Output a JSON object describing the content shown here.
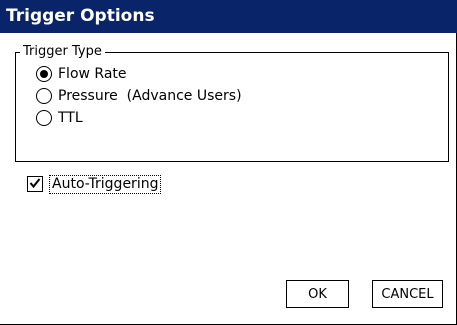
{
  "window": {
    "title": "Trigger Options"
  },
  "trigger_type": {
    "group_label": "Trigger Type",
    "options": [
      {
        "label": "Flow Rate",
        "selected": true
      },
      {
        "label": "Pressure  (Advance Users)",
        "selected": false
      },
      {
        "label": "TTL",
        "selected": false
      }
    ]
  },
  "auto_triggering": {
    "label": "Auto-Triggering",
    "checked": true
  },
  "buttons": {
    "ok_label": "OK",
    "cancel_label": "CANCEL"
  },
  "colors": {
    "titlebar": "#0a246a",
    "background": "#ffffff"
  }
}
